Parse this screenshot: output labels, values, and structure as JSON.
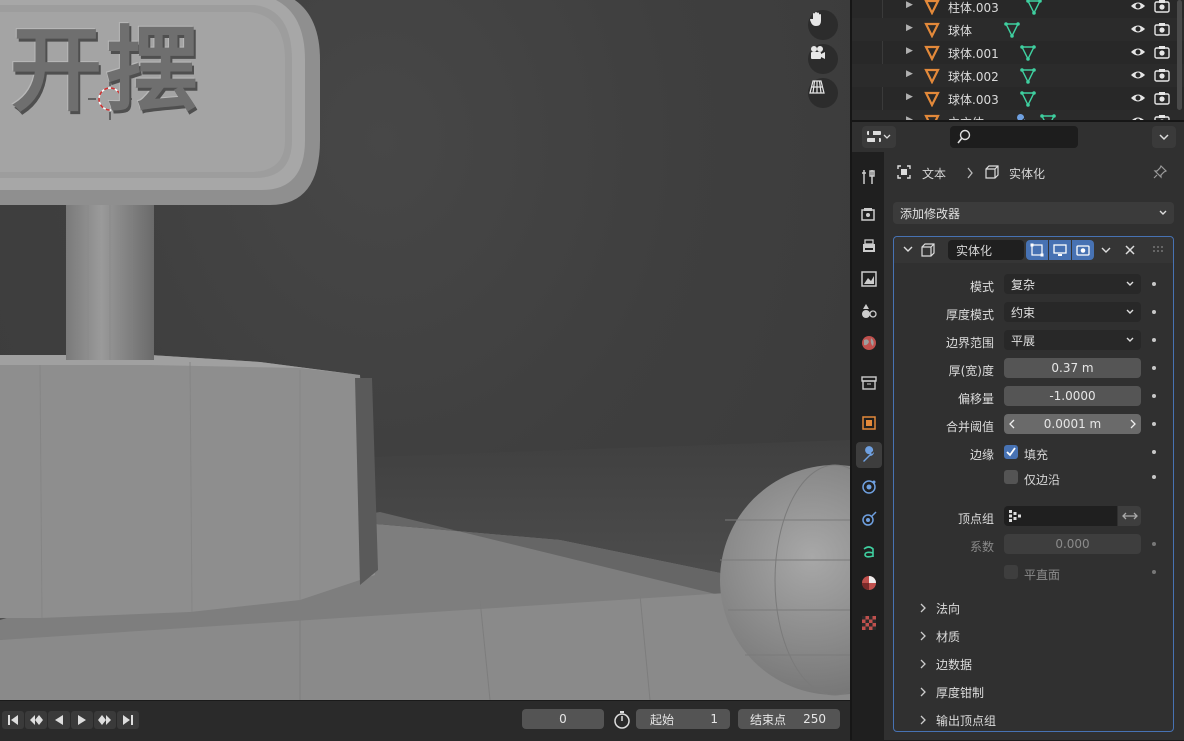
{
  "viewport": {
    "sign_text": "开摆",
    "tools": [
      "hand-icon",
      "camera-icon",
      "grid-icon"
    ]
  },
  "timeline": {
    "current_frame": "0",
    "start_label": "起始",
    "start_value": "1",
    "end_label": "结束点",
    "end_value": "250"
  },
  "outliner": {
    "rows": [
      {
        "name": "柱体.003"
      },
      {
        "name": "球体"
      },
      {
        "name": "球体.001"
      },
      {
        "name": "球体.002"
      },
      {
        "name": "球体.003"
      },
      {
        "name": "立方体"
      }
    ]
  },
  "properties": {
    "breadcrumb": {
      "object": "文本",
      "modifier": "实体化"
    },
    "add_modifier": "添加修改器",
    "modifier": {
      "name": "实体化",
      "mode_label": "模式",
      "mode_value": "复杂",
      "thickness_mode_label": "厚度模式",
      "thickness_mode_value": "约束",
      "boundary_label": "边界范围",
      "boundary_value": "平展",
      "thickness_label": "厚(宽)度",
      "thickness_value": "0.37 m",
      "offset_label": "偏移量",
      "offset_value": "-1.0000",
      "merge_label": "合并阈值",
      "merge_value": "0.0001 m",
      "rim_label": "边缘",
      "fill_label": "填充",
      "fill_checked": true,
      "rim_only_label": "仅边沿",
      "rim_only_checked": false,
      "vgroup_label": "顶点组",
      "factor_label": "系数",
      "factor_value": "0.000",
      "flat_label": "平直面"
    },
    "subpanels": [
      "法向",
      "材质",
      "边数据",
      "厚度钳制",
      "输出顶点组"
    ]
  },
  "colors": {
    "accent_blue": "#4772b3",
    "mesh_green": "#3fd0a0",
    "object_orange": "#e3893a"
  }
}
